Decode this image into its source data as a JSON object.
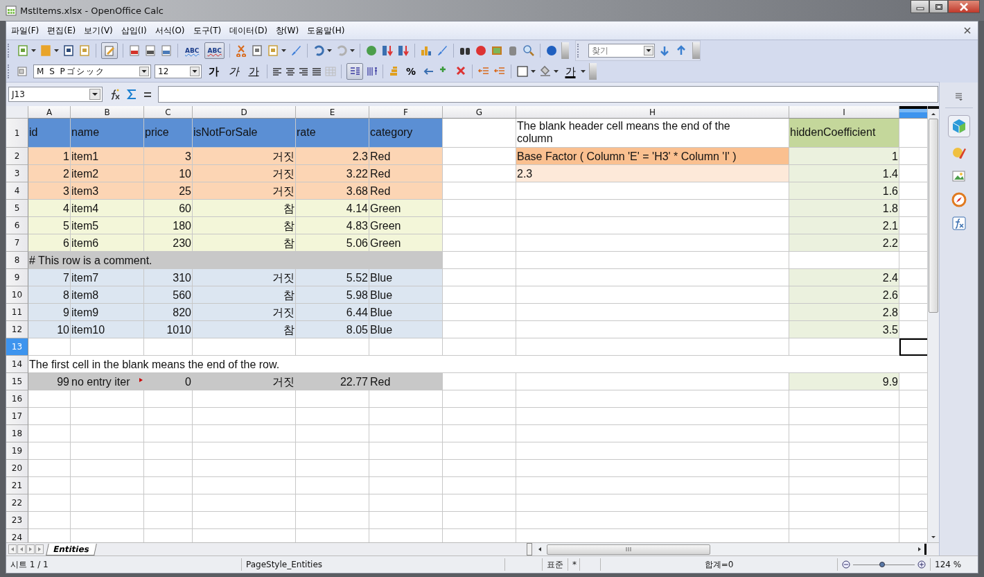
{
  "window": {
    "title": "MstItems.xlsx - OpenOffice Calc"
  },
  "menu": [
    {
      "label": "파일(F)"
    },
    {
      "label": "편집(E)"
    },
    {
      "label": "보기(V)"
    },
    {
      "label": "삽입(I)"
    },
    {
      "label": "서식(O)"
    },
    {
      "label": "도구(T)"
    },
    {
      "label": "데이터(D)"
    },
    {
      "label": "창(W)"
    },
    {
      "label": "도움말(H)"
    }
  ],
  "standard_toolbar": {
    "edit_file_on": true,
    "spellcheck": {
      "label": "ABC"
    },
    "autospell": {
      "label": "ABC",
      "on": true
    },
    "find": {
      "placeholder": "찾기"
    }
  },
  "formatting_toolbar": {
    "font": "M S Pゴシック",
    "size": "12",
    "bold": "가",
    "italic": "가",
    "underline": "가",
    "wrap_on": true,
    "percent": "%",
    "font_color": "가"
  },
  "formula_bar": {
    "name_box": "J13"
  },
  "sheet": {
    "columns": [
      {
        "label": "A",
        "selected": false
      },
      {
        "label": "B",
        "selected": false
      },
      {
        "label": "C",
        "selected": false
      },
      {
        "label": "D",
        "selected": false
      },
      {
        "label": "E",
        "selected": false
      },
      {
        "label": "F",
        "selected": false
      },
      {
        "label": "G",
        "selected": false
      },
      {
        "label": "H",
        "selected": false
      },
      {
        "label": "I",
        "selected": false
      },
      {
        "selected": true
      }
    ],
    "rows": [
      {
        "label": "1",
        "selected": false,
        "cells": {
          "A": {
            "text": "id",
            "color": "#5b8fd4"
          },
          "B": {
            "text": "name",
            "color": "#5b8fd4"
          },
          "C": {
            "text": "price",
            "color": "#5b8fd4"
          },
          "D": {
            "text": "isNotForSale",
            "color": "#5b8fd4"
          },
          "E": {
            "text": "rate",
            "color": "#5b8fd4"
          },
          "F": {
            "text": "category",
            "color": "#5b8fd4"
          },
          "H": {
            "text": "The blank header cell means the end of the column"
          },
          "I": {
            "text": "hiddenCoefficient",
            "color": "#c4d79b"
          }
        }
      },
      {
        "label": "2",
        "selected": false,
        "cells": {
          "A": {
            "text": "1",
            "kind": "number",
            "color": "#fcd5b4"
          },
          "B": {
            "text": "item1",
            "color": "#fcd5b4"
          },
          "C": {
            "text": "3",
            "kind": "number",
            "color": "#fcd5b4"
          },
          "D": {
            "text": "거짓",
            "kind": "boolean",
            "color": "#fcd5b4"
          },
          "E": {
            "text": "2.3",
            "kind": "number",
            "color": "#fcd5b4"
          },
          "F": {
            "text": "Red",
            "color": "#fcd5b4"
          },
          "H": {
            "text": "Base Factor ( Column 'E' = 'H3' * Column 'I' )",
            "color": "#fac090"
          },
          "I": {
            "text": "1",
            "kind": "number",
            "color": "#ebf1de"
          }
        }
      },
      {
        "label": "3",
        "selected": false,
        "cells": {
          "A": {
            "text": "2",
            "kind": "number",
            "color": "#fcd5b4"
          },
          "B": {
            "text": "item2",
            "color": "#fcd5b4"
          },
          "C": {
            "text": "10",
            "kind": "number",
            "color": "#fcd5b4"
          },
          "D": {
            "text": "거짓",
            "kind": "boolean",
            "color": "#fcd5b4"
          },
          "E": {
            "text": "3.22",
            "kind": "number",
            "color": "#fcd5b4"
          },
          "F": {
            "text": "Red",
            "color": "#fcd5b4"
          },
          "H": {
            "text": "2.3",
            "color": "#fde9d9"
          },
          "I": {
            "text": "1.4",
            "kind": "number",
            "color": "#ebf1de"
          }
        }
      },
      {
        "label": "4",
        "selected": false,
        "cells": {
          "A": {
            "text": "3",
            "kind": "number",
            "color": "#fcd5b4"
          },
          "B": {
            "text": "item3",
            "color": "#fcd5b4"
          },
          "C": {
            "text": "25",
            "kind": "number",
            "color": "#fcd5b4"
          },
          "D": {
            "text": "거짓",
            "kind": "boolean",
            "color": "#fcd5b4"
          },
          "E": {
            "text": "3.68",
            "kind": "number",
            "color": "#fcd5b4"
          },
          "F": {
            "text": "Red",
            "color": "#fcd5b4"
          },
          "I": {
            "text": "1.6",
            "kind": "number",
            "color": "#ebf1de"
          }
        }
      },
      {
        "label": "5",
        "selected": false,
        "cells": {
          "A": {
            "text": "4",
            "kind": "number",
            "color": "#f3f6d9"
          },
          "B": {
            "text": "item4",
            "color": "#f3f6d9"
          },
          "C": {
            "text": "60",
            "kind": "number",
            "color": "#f3f6d9"
          },
          "D": {
            "text": "참",
            "kind": "boolean",
            "color": "#f3f6d9"
          },
          "E": {
            "text": "4.14",
            "kind": "number",
            "color": "#f3f6d9"
          },
          "F": {
            "text": "Green",
            "color": "#f3f6d9"
          },
          "I": {
            "text": "1.8",
            "kind": "number",
            "color": "#ebf1de"
          }
        }
      },
      {
        "label": "6",
        "selected": false,
        "cells": {
          "A": {
            "text": "5",
            "kind": "number",
            "color": "#f3f6d9"
          },
          "B": {
            "text": "item5",
            "color": "#f3f6d9"
          },
          "C": {
            "text": "180",
            "kind": "number",
            "color": "#f3f6d9"
          },
          "D": {
            "text": "참",
            "kind": "boolean",
            "color": "#f3f6d9"
          },
          "E": {
            "text": "4.83",
            "kind": "number",
            "color": "#f3f6d9"
          },
          "F": {
            "text": "Green",
            "color": "#f3f6d9"
          },
          "I": {
            "text": "2.1",
            "kind": "number",
            "color": "#ebf1de"
          }
        }
      },
      {
        "label": "7",
        "selected": false,
        "cells": {
          "A": {
            "text": "6",
            "kind": "number",
            "color": "#f3f6d9"
          },
          "B": {
            "text": "item6",
            "color": "#f3f6d9"
          },
          "C": {
            "text": "230",
            "kind": "number",
            "color": "#f3f6d9"
          },
          "D": {
            "text": "참",
            "kind": "boolean",
            "color": "#f3f6d9"
          },
          "E": {
            "text": "5.06",
            "kind": "number",
            "color": "#f3f6d9"
          },
          "F": {
            "text": "Green",
            "color": "#f3f6d9"
          },
          "I": {
            "text": "2.2",
            "kind": "number",
            "color": "#ebf1de"
          }
        }
      },
      {
        "label": "8",
        "selected": false,
        "cells": {
          "A": {
            "text": "# This row is a comment.",
            "color": "#c8c8c8"
          },
          "B": {
            "color": "#c8c8c8"
          },
          "C": {
            "color": "#c8c8c8"
          },
          "D": {
            "color": "#c8c8c8"
          },
          "E": {
            "color": "#c8c8c8"
          },
          "F": {
            "color": "#c8c8c8"
          }
        }
      },
      {
        "label": "9",
        "selected": false,
        "cells": {
          "A": {
            "text": "7",
            "kind": "number",
            "color": "#dce6f1"
          },
          "B": {
            "text": "item7",
            "color": "#dce6f1"
          },
          "C": {
            "text": "310",
            "kind": "number",
            "color": "#dce6f1"
          },
          "D": {
            "text": "거짓",
            "kind": "boolean",
            "color": "#dce6f1"
          },
          "E": {
            "text": "5.52",
            "kind": "number",
            "color": "#dce6f1"
          },
          "F": {
            "text": "Blue",
            "color": "#dce6f1"
          },
          "I": {
            "text": "2.4",
            "kind": "number",
            "color": "#ebf1de"
          }
        }
      },
      {
        "label": "10",
        "selected": false,
        "cells": {
          "A": {
            "text": "8",
            "kind": "number",
            "color": "#dce6f1"
          },
          "B": {
            "text": "item8",
            "color": "#dce6f1"
          },
          "C": {
            "text": "560",
            "kind": "number",
            "color": "#dce6f1"
          },
          "D": {
            "text": "참",
            "kind": "boolean",
            "color": "#dce6f1"
          },
          "E": {
            "text": "5.98",
            "kind": "number",
            "color": "#dce6f1"
          },
          "F": {
            "text": "Blue",
            "color": "#dce6f1"
          },
          "I": {
            "text": "2.6",
            "kind": "number",
            "color": "#ebf1de"
          }
        }
      },
      {
        "label": "11",
        "selected": false,
        "cells": {
          "A": {
            "text": "9",
            "kind": "number",
            "color": "#dce6f1"
          },
          "B": {
            "text": "item9",
            "color": "#dce6f1"
          },
          "C": {
            "text": "820",
            "kind": "number",
            "color": "#dce6f1"
          },
          "D": {
            "text": "거짓",
            "kind": "boolean",
            "color": "#dce6f1"
          },
          "E": {
            "text": "6.44",
            "kind": "number",
            "color": "#dce6f1"
          },
          "F": {
            "text": "Blue",
            "color": "#dce6f1"
          },
          "I": {
            "text": "2.8",
            "kind": "number",
            "color": "#ebf1de"
          }
        }
      },
      {
        "label": "12",
        "selected": false,
        "cells": {
          "A": {
            "text": "10",
            "kind": "number",
            "color": "#dce6f1"
          },
          "B": {
            "text": "item10",
            "color": "#dce6f1"
          },
          "C": {
            "text": "1010",
            "kind": "number",
            "color": "#dce6f1"
          },
          "D": {
            "text": "참",
            "kind": "boolean",
            "color": "#dce6f1"
          },
          "E": {
            "text": "8.05",
            "kind": "number",
            "color": "#dce6f1"
          },
          "F": {
            "text": "Blue",
            "color": "#dce6f1"
          },
          "I": {
            "text": "3.5",
            "kind": "number",
            "color": "#ebf1de"
          }
        }
      },
      {
        "label": "13",
        "selected": true
      },
      {
        "label": "14",
        "selected": false,
        "cells": {
          "A": {
            "text": "The first cell in the blank means the end of the row."
          }
        }
      },
      {
        "label": "15",
        "selected": false,
        "cells": {
          "A": {
            "text": "99",
            "kind": "number",
            "color": "#c8c8c8"
          },
          "B": {
            "text": "no entry iter",
            "comment": true,
            "color": "#c8c8c8"
          },
          "C": {
            "text": "0",
            "kind": "number",
            "color": "#c8c8c8"
          },
          "D": {
            "text": "거짓",
            "kind": "boolean",
            "color": "#c8c8c8"
          },
          "E": {
            "text": "22.77",
            "kind": "number",
            "color": "#c8c8c8"
          },
          "F": {
            "text": "Red",
            "color": "#c8c8c8"
          },
          "I": {
            "text": "9.9",
            "kind": "number",
            "color": "#ebf1de"
          }
        }
      },
      {
        "label": "16",
        "selected": false
      },
      {
        "label": "17",
        "selected": false
      },
      {
        "label": "18",
        "selected": false
      },
      {
        "label": "19",
        "selected": false
      },
      {
        "label": "20",
        "selected": false
      },
      {
        "label": "21",
        "selected": false
      },
      {
        "label": "22",
        "selected": false
      },
      {
        "label": "23",
        "selected": false
      },
      {
        "label": "24",
        "selected": false
      }
    ]
  },
  "sheet_tabs": [
    {
      "label": "Entities",
      "selected": true
    }
  ],
  "status_bar": {
    "sheet": "시트 1 / 1",
    "page_style": "PageStyle_Entities",
    "mode": "표준",
    "modified": "*",
    "sum": "합계=0",
    "zoom": {
      "level": 0.47
    },
    "zoom_reading": "124 %"
  }
}
